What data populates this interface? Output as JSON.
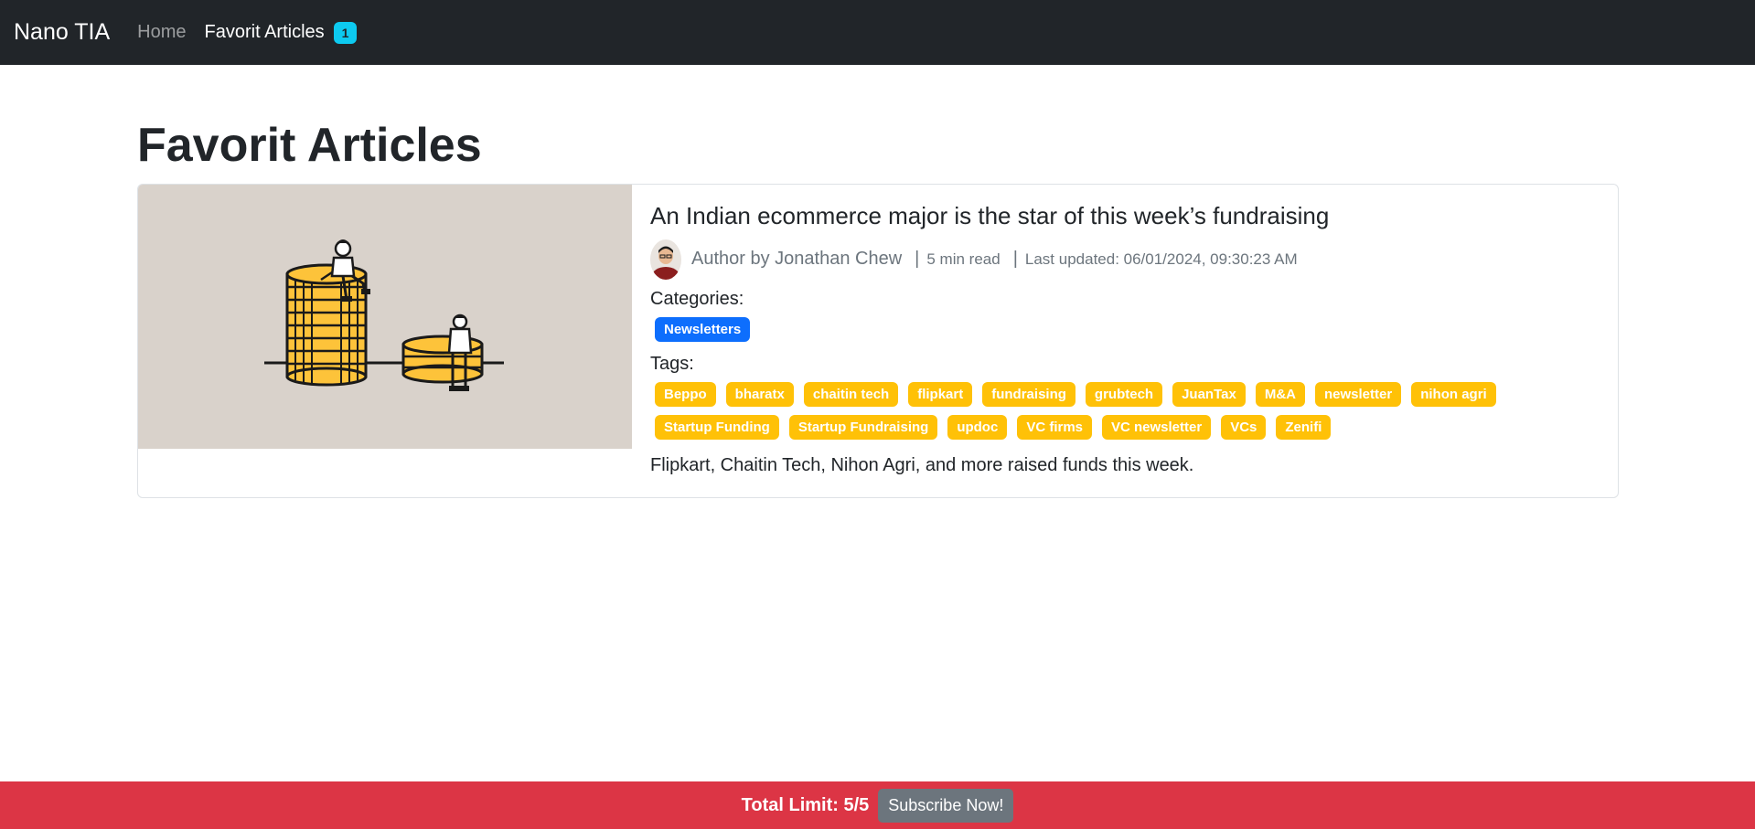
{
  "navbar": {
    "brand": "Nano TIA",
    "links": [
      {
        "label": "Home"
      },
      {
        "label": "Favorit Articles",
        "badge": "1"
      }
    ]
  },
  "main": {
    "title": "Favorit Articles",
    "article": {
      "title": "An Indian ecommerce major is the star of this week’s fundraising",
      "author": "Author by Jonathan Chew",
      "read_time": "5 min read",
      "last_updated": "Last updated: 06/01/2024, 09:30:23 AM",
      "categories_label": "Categories:",
      "categories": [
        "Newsletters"
      ],
      "tags_label": "Tags:",
      "tags": [
        "Beppo",
        "bharatx",
        "chaitin tech",
        "flipkart",
        "fundraising",
        "grubtech",
        "JuanTax",
        "M&A",
        "newsletter",
        "nihon agri",
        "Startup Funding",
        "Startup Fundraising",
        "updoc",
        "VC firms",
        "VC newsletter",
        "VCs",
        "Zenifi"
      ],
      "summary": "Flipkart, Chaitin Tech, Nihon Agri, and more raised funds this week.",
      "separator": "|"
    }
  },
  "footer": {
    "limit_text": "Total Limit: 5/5",
    "subscribe_label": "Subscribe Now!"
  },
  "colors": {
    "navbar": "#212529",
    "badge": "#0dcaf0",
    "category": "#0d6efd",
    "tag": "#ffc107",
    "footer": "#dc3545",
    "button": "#6c757d"
  }
}
